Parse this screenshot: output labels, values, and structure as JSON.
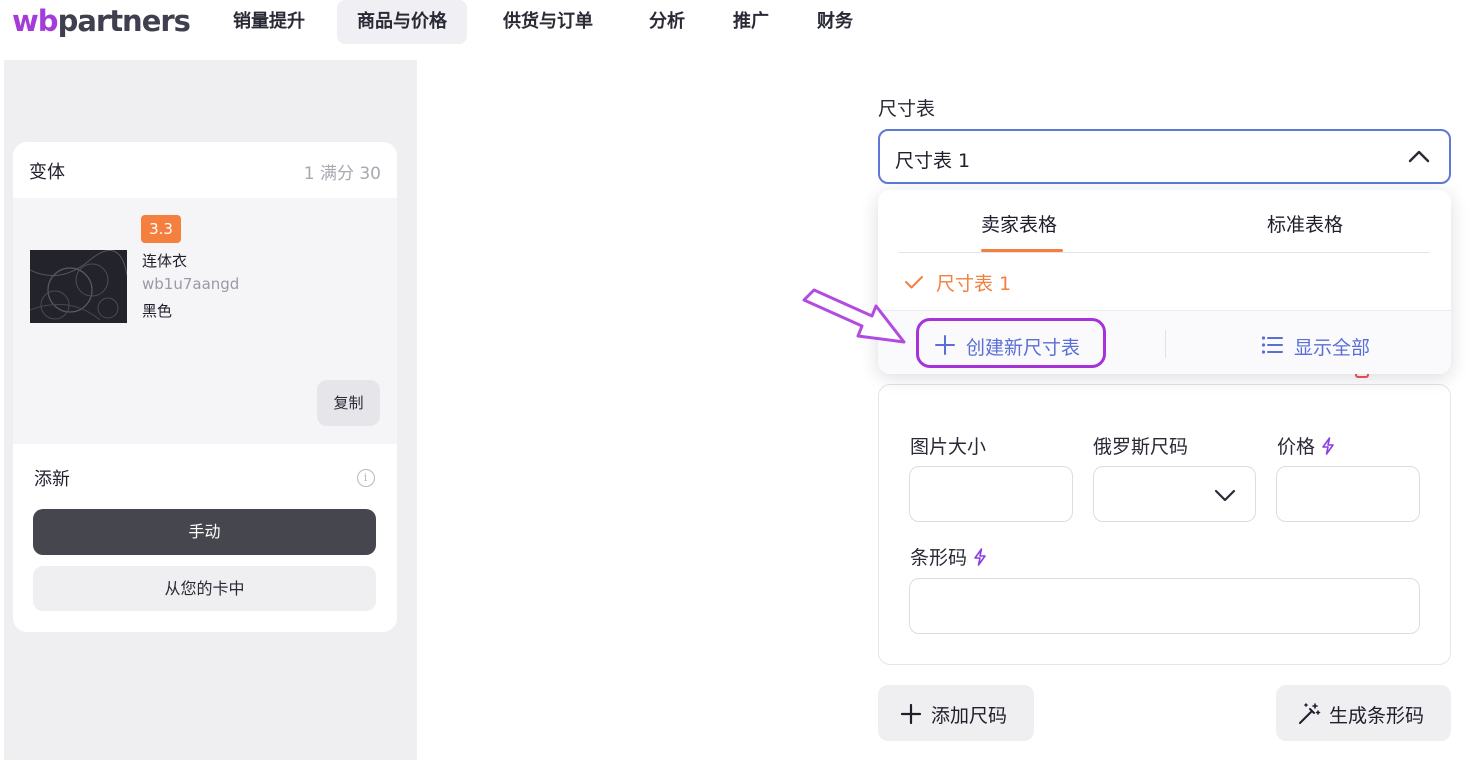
{
  "brand": {
    "logo_wb": "wb",
    "logo_partners": "partners"
  },
  "nav": {
    "items": [
      {
        "label": "销量提升"
      },
      {
        "label": "商品与价格",
        "active": true
      },
      {
        "label": "供货与订单"
      },
      {
        "label": "分析"
      },
      {
        "label": "推广"
      },
      {
        "label": "财务"
      }
    ]
  },
  "variants": {
    "title": "变体",
    "count": "1 满分 30",
    "product": {
      "rating": "3.3",
      "name": "连体衣",
      "code": "wb1u7aangd",
      "color": "黑色"
    },
    "copy_label": "复制"
  },
  "add_new": {
    "title": "添新",
    "manual_label": "手动",
    "from_card_label": "从您的卡中"
  },
  "size_table": {
    "label": "尺寸表",
    "selected": "尺寸表 1",
    "dropdown": {
      "tabs": [
        "卖家表格",
        "标准表格"
      ],
      "options": [
        "尺寸表 1"
      ],
      "create_label": "创建新尺寸表",
      "show_all_label": "显示全部"
    }
  },
  "size_form": {
    "image_size_label": "图片大小",
    "russian_size_label": "俄罗斯尺码",
    "price_label": "价格",
    "barcode_label": "条形码"
  },
  "actions": {
    "add_size_label": "添加尺码",
    "generate_barcode_label": "生成条形码"
  },
  "colors": {
    "accent_orange": "#f47f3f",
    "brand_purple": "#a733d8",
    "link_blue": "#5a6fd6",
    "focus_border": "#5e78d8"
  }
}
